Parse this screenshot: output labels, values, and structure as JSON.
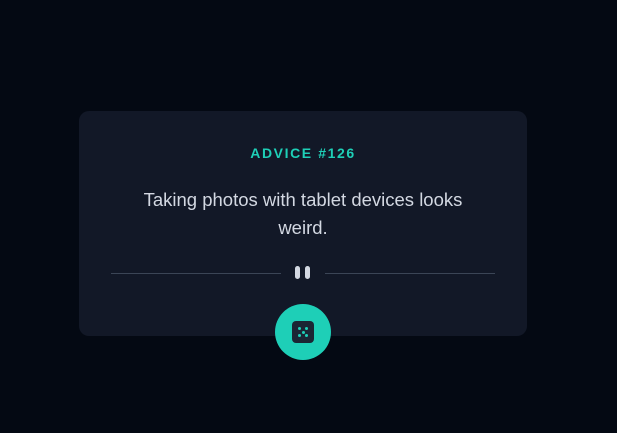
{
  "card": {
    "advice_title": "ADVICE #126",
    "advice_text": "Taking photos with tablet devices looks weird."
  },
  "divider": {
    "icon": "pause-icon"
  },
  "dice_button": {
    "icon": "dice-icon"
  },
  "colors": {
    "background": "#040913",
    "card": "#121827",
    "accent": "#1ecfb7",
    "text": "#d3d8e2",
    "divider_line": "#3b4556"
  }
}
